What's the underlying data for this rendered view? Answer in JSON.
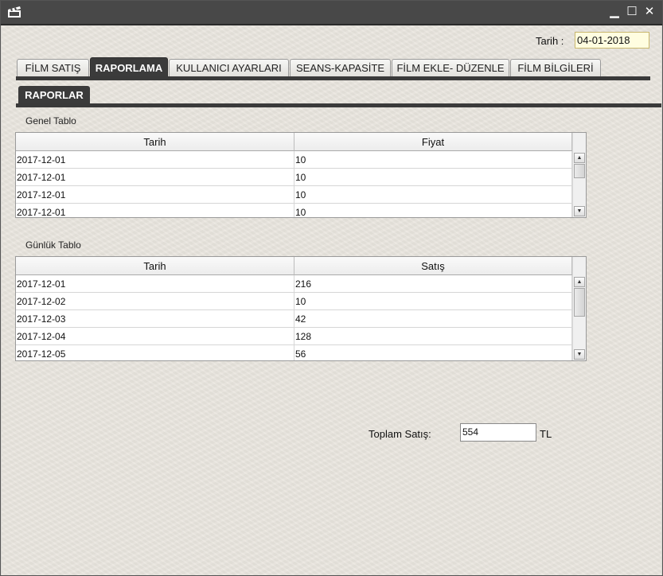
{
  "window": {
    "minimize": "▁",
    "maximize": "☐",
    "close": "✕"
  },
  "header": {
    "tarih_label": "Tarih :",
    "tarih_value": "04-01-2018"
  },
  "tabs": [
    {
      "label": "FİLM SATIŞ"
    },
    {
      "label": "RAPORLAMA"
    },
    {
      "label": "KULLANICI AYARLARI"
    },
    {
      "label": "SEANS-KAPASİTE"
    },
    {
      "label": "FİLM EKLE- DÜZENLE"
    },
    {
      "label": "FİLM BİLGİLERİ"
    }
  ],
  "subtab": {
    "label": "RAPORLAR"
  },
  "genel": {
    "title": "Genel Tablo",
    "columns": [
      "Tarih",
      "Fiyat"
    ],
    "rows": [
      [
        "2017-12-01",
        "10"
      ],
      [
        "2017-12-01",
        "10"
      ],
      [
        "2017-12-01",
        "10"
      ],
      [
        "2017-12-01",
        "10"
      ]
    ]
  },
  "gunluk": {
    "title": "Günlük Tablo",
    "columns": [
      "Tarih",
      "Satış"
    ],
    "rows": [
      [
        "2017-12-01",
        "216"
      ],
      [
        "2017-12-02",
        "10"
      ],
      [
        "2017-12-03",
        "42"
      ],
      [
        "2017-12-04",
        "128"
      ],
      [
        "2017-12-05",
        "56"
      ]
    ]
  },
  "total": {
    "label": "Toplam Satış:",
    "value": "554",
    "unit": "TL"
  }
}
